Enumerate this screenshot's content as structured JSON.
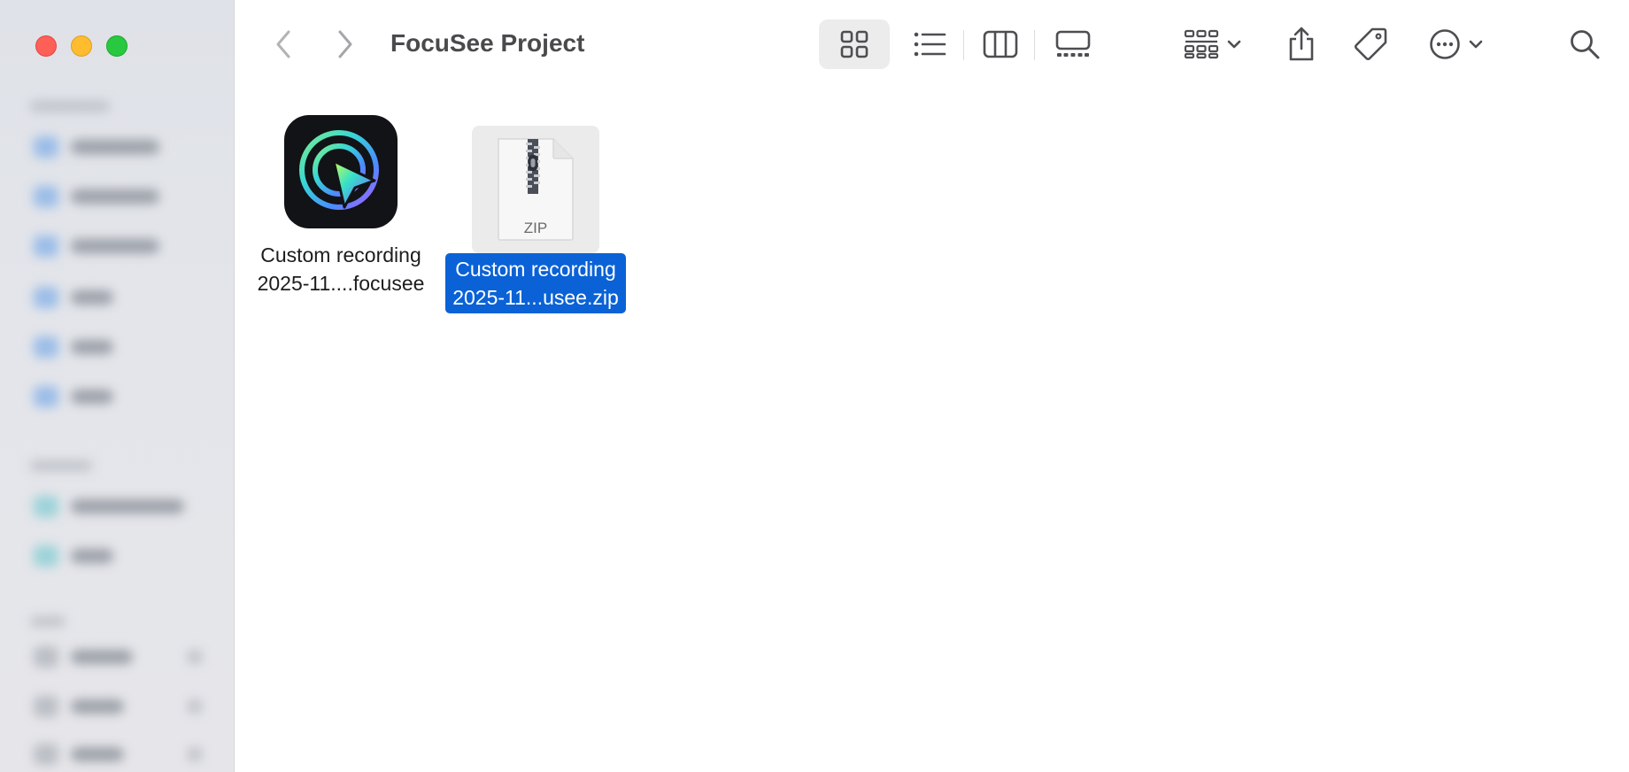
{
  "window": {
    "title": "FocuSee Project"
  },
  "toolbar": {
    "icons": {
      "back": "chevron-left-icon",
      "forward": "chevron-right-icon",
      "icon_view": "grid-view-icon",
      "list_view": "list-view-icon",
      "column_view": "column-view-icon",
      "gallery_view": "gallery-view-icon",
      "group": "group-by-icon",
      "share": "share-icon",
      "tags": "tag-icon",
      "more": "ellipsis-circle-icon",
      "search": "search-icon"
    },
    "active_view": "icon"
  },
  "files": [
    {
      "name_line1": "Custom recording",
      "name_line2": "2025-11....focusee",
      "kind": "focusee-app-icon",
      "selected": false
    },
    {
      "name_line1": "Custom recording",
      "name_line2": "2025-11...usee.zip",
      "kind": "zip-archive-icon",
      "badge": "ZIP",
      "selected": true
    }
  ],
  "colors": {
    "selection": "#0a62d6",
    "close": "#fe5f57",
    "minimize": "#febc2e",
    "maximize": "#28c840"
  }
}
